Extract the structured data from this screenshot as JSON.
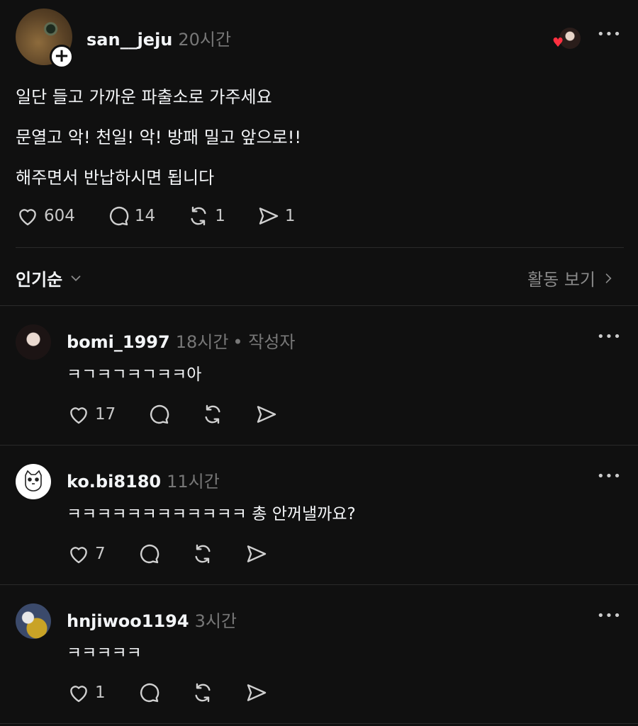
{
  "post": {
    "username": "san__jeju",
    "time": "20시간",
    "lines": [
      "일단 들고 가까운 파출소로 가주세요",
      "문열고 악! 천일! 악! 방패 밀고 앞으로!!",
      "해주면서 반납하시면 됩니다"
    ],
    "likes": "604",
    "replies": "14",
    "reposts": "1",
    "shares": "1"
  },
  "sort": {
    "label": "인기순",
    "activity_label": "활동 보기"
  },
  "comments": [
    {
      "username": "bomi_1997",
      "time": "18시간",
      "author_badge": "• 작성자",
      "text": "ㅋㄱㅋㄱㅋㄱㅋㅋ아",
      "likes": "17"
    },
    {
      "username": "ko.bi8180",
      "time": "11시간",
      "author_badge": "",
      "text": "ㅋㅋㅋㅋㅋㅋㅋㅋㅋㅋㅋㅋ  총 안꺼낼까요?",
      "likes": "7"
    },
    {
      "username": "hnjiwoo1194",
      "time": "3시간",
      "author_badge": "",
      "text": "ㅋㅋㅋㅋㅋ",
      "likes": "1"
    }
  ],
  "icons": {
    "more": "more-horizontal-icon",
    "like": "heart-icon",
    "reply": "comment-icon",
    "repost": "repost-icon",
    "share": "send-icon"
  },
  "colors": {
    "background": "#101010",
    "text": "#f3f5f7",
    "muted": "#777777",
    "heart": "#ff3040"
  }
}
